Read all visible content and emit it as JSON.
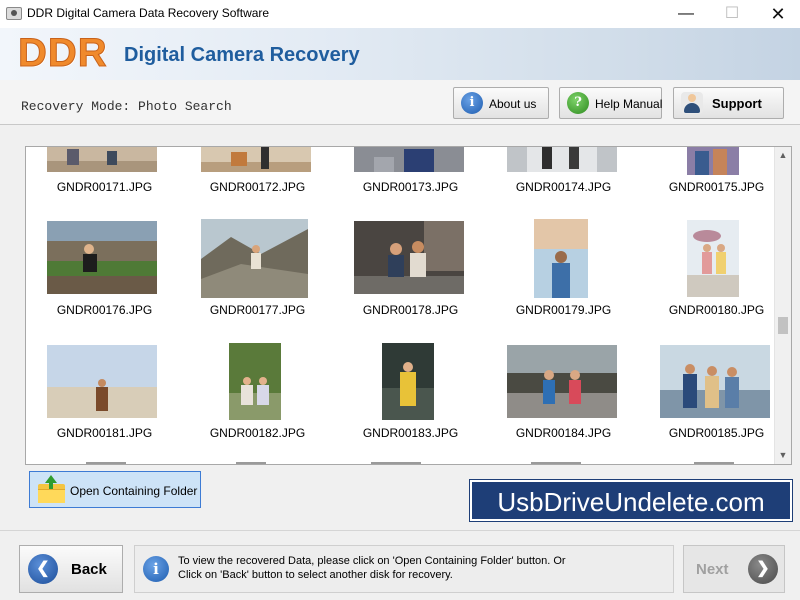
{
  "window": {
    "title": "DDR Digital Camera Data Recovery Software",
    "minimize_glyph": "—",
    "maximize_glyph": "☐",
    "close_glyph": "✕"
  },
  "header": {
    "logo": "DDR",
    "title": "Digital Camera Recovery",
    "logo_color": "#f08a2c",
    "title_color": "#1f5d9e"
  },
  "toolbar": {
    "mode": "Recovery Mode: Photo Search",
    "about_label": "About us",
    "help_label": "Help Manual",
    "support_label": "Support",
    "about_icon": "info-icon",
    "help_icon": "question-icon",
    "support_icon": "person-icon",
    "about_glyph": "i",
    "help_glyph": "?"
  },
  "gallery": {
    "rows": [
      {
        "files": [
          "GNDR00171.JPG",
          "GNDR00172.JPG",
          "GNDR00173.JPG",
          "GNDR00174.JPG",
          "GNDR00175.JPG"
        ]
      },
      {
        "files": [
          "GNDR00176.JPG",
          "GNDR00177.JPG",
          "GNDR00178.JPG",
          "GNDR00179.JPG",
          "GNDR00180.JPG"
        ]
      },
      {
        "files": [
          "GNDR00181.JPG",
          "GNDR00182.JPG",
          "GNDR00183.JPG",
          "GNDR00184.JPG",
          "GNDR00185.JPG"
        ]
      }
    ],
    "scroll_up_glyph": "▲",
    "scroll_down_glyph": "▼"
  },
  "actions": {
    "open_folder_label": "Open Containing Folder"
  },
  "brand": {
    "text": "UsbDriveUndelete.com",
    "color": "#1e3e77"
  },
  "footer": {
    "back_label": "Back",
    "back_glyph": "❮",
    "next_label": "Next",
    "next_glyph": "❯",
    "info_glyph": "i",
    "info_line1": "To view the recovered Data, please click on 'Open Containing Folder' button. Or",
    "info_line2": "Click on 'Back' button to select another disk for recovery."
  }
}
